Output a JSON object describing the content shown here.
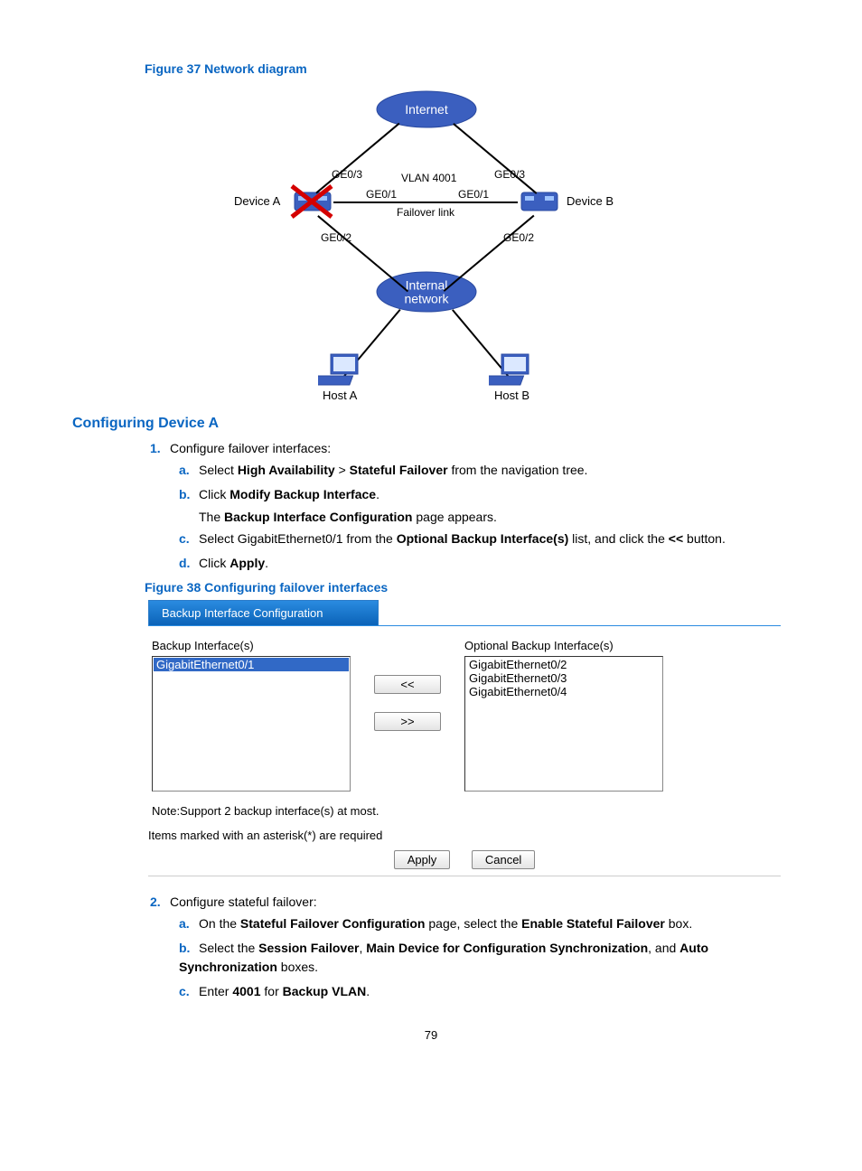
{
  "fig37": {
    "caption": "Figure 37 Network diagram"
  },
  "diagram": {
    "internet": "Internet",
    "internal1": "Internal",
    "internal2": "network",
    "deviceA": "Device A",
    "deviceB": "Device B",
    "hostA": "Host A",
    "hostB": "Host B",
    "ge03l": "GE0/3",
    "ge03r": "GE0/3",
    "ge01l": "GE0/1",
    "ge01r": "GE0/1",
    "ge02l": "GE0/2",
    "ge02r": "GE0/2",
    "vlan": "VLAN 4001",
    "failover": "Failover link"
  },
  "sectionA": "Configuring Device A",
  "step1": {
    "num": "1.",
    "text": "Configure failover interfaces:",
    "a": {
      "l": "a.",
      "t1": "Select ",
      "b1": "High Availability",
      "gt": " > ",
      "b2": "Stateful Failover",
      "t2": " from the navigation tree."
    },
    "b": {
      "l": "b.",
      "t1": "Click ",
      "b1": "Modify Backup Interface",
      "t2": "."
    },
    "b2line": {
      "t1": "The ",
      "b1": "Backup Interface Configuration",
      "t2": " page appears."
    },
    "c": {
      "l": "c.",
      "t1": "Select GigabitEthernet0/1 from the ",
      "b1": "Optional Backup Interface(s)",
      "t2": " list, and click the ",
      "b2": "<<",
      "t3": " button."
    },
    "d": {
      "l": "d.",
      "t1": "Click ",
      "b1": "Apply",
      "t2": "."
    }
  },
  "fig38": {
    "caption": "Figure 38 Configuring failover interfaces"
  },
  "panel": {
    "title": "Backup Interface Configuration",
    "leftLabel": "Backup Interface(s)",
    "rightLabel": "Optional Backup Interface(s)",
    "leftItems": [
      "GigabitEthernet0/1"
    ],
    "rightItems": [
      "GigabitEthernet0/2",
      "GigabitEthernet0/3",
      "GigabitEthernet0/4"
    ],
    "moveLeft": "<<",
    "moveRight": ">>",
    "note": "Note:Support 2 backup interface(s) at most.",
    "required": "Items marked with an asterisk(*) are required",
    "apply": "Apply",
    "cancel": "Cancel"
  },
  "step2": {
    "num": "2.",
    "text": "Configure stateful failover:",
    "a": {
      "l": "a.",
      "t1": "On the ",
      "b1": "Stateful Failover Configuration",
      "t2": " page, select the ",
      "b2": "Enable Stateful Failover",
      "t3": " box."
    },
    "b": {
      "l": "b.",
      "t1": "Select the ",
      "b1": "Session Failover",
      "t2": ", ",
      "b2": "Main Device for Configuration Synchronization",
      "t3": ", and ",
      "b3": "Auto Synchronization",
      "t4": " boxes."
    },
    "c": {
      "l": "c.",
      "t1": "Enter ",
      "b1": "4001",
      "t2": " for ",
      "b2": "Backup VLAN",
      "t3": "."
    }
  },
  "pageNum": "79"
}
